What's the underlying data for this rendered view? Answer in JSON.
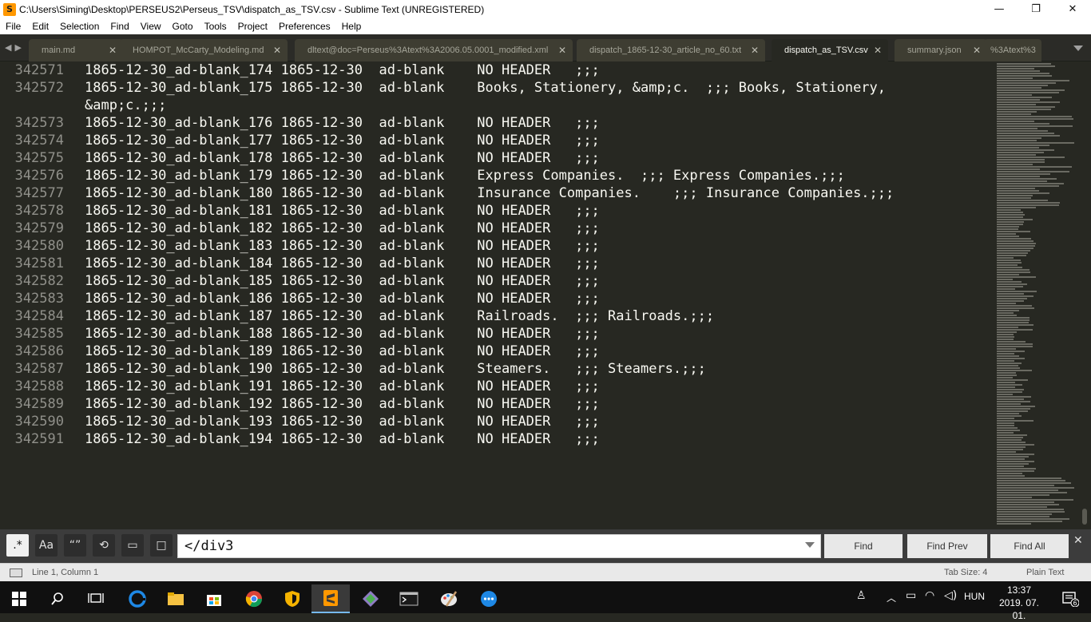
{
  "window": {
    "title": "C:\\Users\\Siming\\Desktop\\PERSEUS2\\Perseus_TSV\\dispatch_as_TSV.csv - Sublime Text (UNREGISTERED)",
    "app_icon_glyph": "S",
    "controls": [
      "—",
      "❐",
      "✕"
    ]
  },
  "menu": [
    "File",
    "Edit",
    "Selection",
    "Find",
    "View",
    "Goto",
    "Tools",
    "Project",
    "Preferences",
    "Help"
  ],
  "tab_nav": "◀▶",
  "tabs": [
    {
      "label": "main.md",
      "close": "✕",
      "active": false
    },
    {
      "label": "HOMPOT_McCarty_Modeling.md",
      "close": "✕",
      "active": false
    },
    {
      "label": "dltext@doc=Perseus%3Atext%3A2006.05.0001_modified.xml",
      "close": "✕",
      "active": false
    },
    {
      "label": "dispatch_1865-12-30_article_no_60.txt",
      "close": "✕",
      "active": false
    },
    {
      "label": "dispatch_as_TSV.csv",
      "close": "✕",
      "active": true
    },
    {
      "label": "summary.json",
      "close": "✕",
      "active": false
    },
    {
      "label": "%3Atext%3",
      "close": "",
      "active": false
    }
  ],
  "editor": {
    "lines": [
      {
        "num": "342571",
        "text": "1865-12-30_ad-blank_174 1865-12-30  ad-blank    NO HEADER   ;;;"
      },
      {
        "num": "342572",
        "text": "1865-12-30_ad-blank_175 1865-12-30  ad-blank    Books, Stationery, &amp;c.  ;;; Books, Stationery,"
      },
      {
        "num": "",
        "text": "&amp;c.;;;"
      },
      {
        "num": "342573",
        "text": "1865-12-30_ad-blank_176 1865-12-30  ad-blank    NO HEADER   ;;;"
      },
      {
        "num": "342574",
        "text": "1865-12-30_ad-blank_177 1865-12-30  ad-blank    NO HEADER   ;;;"
      },
      {
        "num": "342575",
        "text": "1865-12-30_ad-blank_178 1865-12-30  ad-blank    NO HEADER   ;;;"
      },
      {
        "num": "342576",
        "text": "1865-12-30_ad-blank_179 1865-12-30  ad-blank    Express Companies.  ;;; Express Companies.;;;"
      },
      {
        "num": "342577",
        "text": "1865-12-30_ad-blank_180 1865-12-30  ad-blank    Insurance Companies.    ;;; Insurance Companies.;;;"
      },
      {
        "num": "342578",
        "text": "1865-12-30_ad-blank_181 1865-12-30  ad-blank    NO HEADER   ;;;"
      },
      {
        "num": "342579",
        "text": "1865-12-30_ad-blank_182 1865-12-30  ad-blank    NO HEADER   ;;;"
      },
      {
        "num": "342580",
        "text": "1865-12-30_ad-blank_183 1865-12-30  ad-blank    NO HEADER   ;;;"
      },
      {
        "num": "342581",
        "text": "1865-12-30_ad-blank_184 1865-12-30  ad-blank    NO HEADER   ;;;"
      },
      {
        "num": "342582",
        "text": "1865-12-30_ad-blank_185 1865-12-30  ad-blank    NO HEADER   ;;;"
      },
      {
        "num": "342583",
        "text": "1865-12-30_ad-blank_186 1865-12-30  ad-blank    NO HEADER   ;;;"
      },
      {
        "num": "342584",
        "text": "1865-12-30_ad-blank_187 1865-12-30  ad-blank    Railroads.  ;;; Railroads.;;;"
      },
      {
        "num": "342585",
        "text": "1865-12-30_ad-blank_188 1865-12-30  ad-blank    NO HEADER   ;;;"
      },
      {
        "num": "342586",
        "text": "1865-12-30_ad-blank_189 1865-12-30  ad-blank    NO HEADER   ;;;"
      },
      {
        "num": "342587",
        "text": "1865-12-30_ad-blank_190 1865-12-30  ad-blank    Steamers.   ;;; Steamers.;;;"
      },
      {
        "num": "342588",
        "text": "1865-12-30_ad-blank_191 1865-12-30  ad-blank    NO HEADER   ;;;"
      },
      {
        "num": "342589",
        "text": "1865-12-30_ad-blank_192 1865-12-30  ad-blank    NO HEADER   ;;;"
      },
      {
        "num": "342590",
        "text": "1865-12-30_ad-blank_193 1865-12-30  ad-blank    NO HEADER   ;;;"
      },
      {
        "num": "342591",
        "text": "1865-12-30_ad-blank_194 1865-12-30  ad-blank    NO HEADER   ;;;"
      }
    ]
  },
  "find_panel": {
    "regex_glyph": ".*",
    "case_glyph": "Aa",
    "word_glyph": "“”",
    "wrap_glyph": "⟲",
    "selection_glyph": "▭",
    "highlight_glyph": "□",
    "query": "</div3",
    "find_label": "Find",
    "find_prev_label": "Find Prev",
    "find_all_label": "Find All",
    "close_glyph": "✕"
  },
  "status": {
    "position": "Line 1, Column 1",
    "tab_size": "Tab Size: 4",
    "syntax": "Plain Text"
  },
  "taskbar": {
    "language": "HUN",
    "time": "13:37",
    "date": "2019. 07. 01.",
    "notification_count": "6"
  },
  "colors": {
    "editor_bg": "#272822",
    "text": "#f8f8f2",
    "gutter": "#90908a",
    "tab_inactive": "#3e3d32",
    "sublime_orange": "#ff9800"
  }
}
